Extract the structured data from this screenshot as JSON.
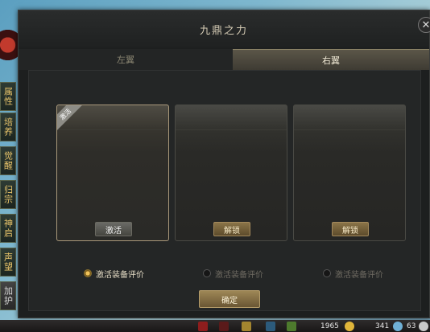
{
  "window": {
    "title": "九鼎之力",
    "close_icon": "close-icon"
  },
  "tabs": [
    {
      "label": "左翼",
      "selected": false
    },
    {
      "label": "右翼",
      "selected": true
    }
  ],
  "cards": [
    {
      "ribbon": "激活",
      "button": "激活",
      "state": "active"
    },
    {
      "ribbon": "",
      "button": "解锁",
      "state": "locked"
    },
    {
      "ribbon": "",
      "button": "解锁",
      "state": "locked"
    }
  ],
  "radios": [
    {
      "label": "激活装备评价",
      "checked": true
    },
    {
      "label": "激活装备评价",
      "checked": false
    },
    {
      "label": "激活装备评价",
      "checked": false
    }
  ],
  "confirm_label": "确定",
  "side_tabs": [
    {
      "label": "属性"
    },
    {
      "label": "培养"
    },
    {
      "label": "觉醒"
    },
    {
      "label": "归宗"
    },
    {
      "label": "神启"
    },
    {
      "label": "声望"
    },
    {
      "label": "加护"
    }
  ],
  "hud": {
    "left_value": "1965",
    "mid_value": "341",
    "right_value": "63"
  },
  "colors": {
    "accent": "#e9c46a",
    "panel_bg": "#1d1f1f",
    "button_gold": "#9e8756"
  }
}
